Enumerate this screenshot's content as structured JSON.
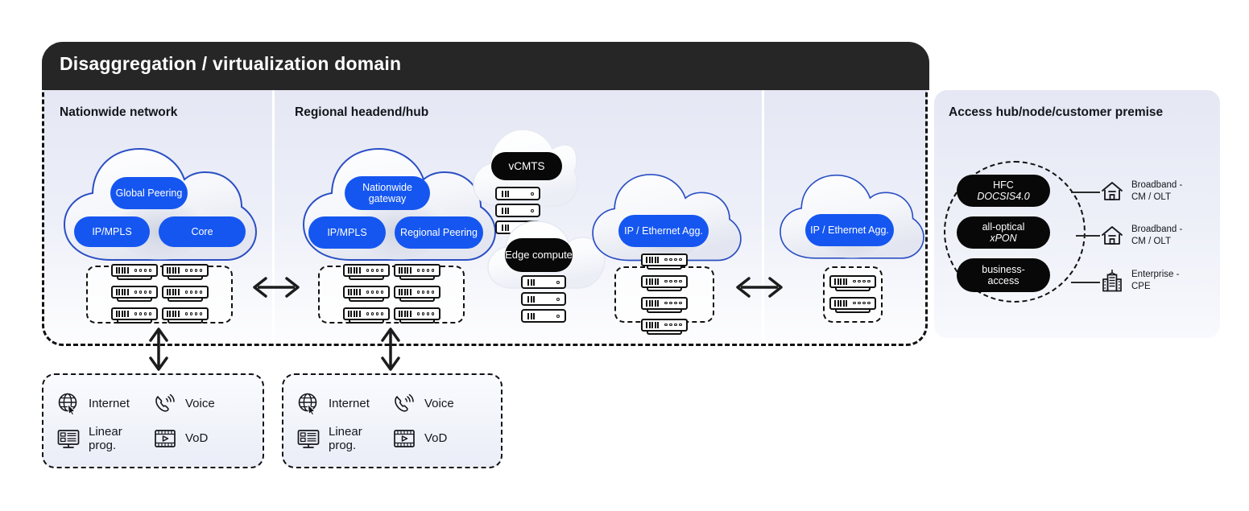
{
  "diagram": {
    "domain": {
      "title": "Disaggregation / virtualization domain",
      "zones": [
        {
          "id": "nationwide",
          "title": "Nationwide network"
        },
        {
          "id": "regional",
          "title": "Regional headend/hub"
        },
        {
          "id": "aggregation",
          "title": ""
        }
      ]
    },
    "access_panel": {
      "title": "Access hub/node/customer premise"
    },
    "clouds": [
      {
        "id": "nationwide-network-cloud",
        "zone": "nationwide",
        "pills": [
          {
            "label": "Global Peering",
            "color": "#1556f0"
          },
          {
            "label": "IP/MPLS",
            "color": "#1556f0"
          },
          {
            "label": "Core",
            "color": "#1556f0"
          }
        ],
        "servers": 6
      },
      {
        "id": "regional-headend-cloud",
        "zone": "regional",
        "pills": [
          {
            "label": "Nationwide gateway",
            "color": "#1556f0"
          },
          {
            "label": "IP/MPLS",
            "color": "#1556f0"
          },
          {
            "label": "Regional Peering",
            "color": "#1556f0"
          }
        ],
        "servers": 6
      },
      {
        "id": "vcmts-cloud",
        "zone": "regional",
        "pills": [
          {
            "label": "vCMTS",
            "color": "#080808"
          }
        ],
        "servers": 3
      },
      {
        "id": "edge-compute-cloud",
        "zone": "regional",
        "pills": [
          {
            "label": "Edge compute",
            "color": "#080808"
          }
        ],
        "servers": 3
      },
      {
        "id": "regional-ip-ethernet-agg-cloud",
        "zone": "regional",
        "pills": [
          {
            "label": "IP / Ethernet Agg.",
            "color": "#1556f0"
          }
        ],
        "servers": 4
      },
      {
        "id": "access-ip-ethernet-agg-cloud",
        "zone": "aggregation",
        "pills": [
          {
            "label": "IP / Ethernet Agg.",
            "color": "#1556f0"
          }
        ],
        "servers": 2
      }
    ],
    "cloud_labels": {
      "global_peering": "Global Peering",
      "ip_mpls_1": "IP/MPLS",
      "core": "Core",
      "nationwide_gateway": "Nationwide gateway",
      "ip_mpls_2": "IP/MPLS",
      "regional_peering": "Regional Peering",
      "vcmts": "vCMTS",
      "edge_compute": "Edge compute",
      "ip_eth_agg_1": "IP / Ethernet Agg.",
      "ip_eth_agg_2": "IP / Ethernet Agg."
    },
    "access_technologies": [
      {
        "line1": "HFC",
        "line2": "DOCSIS4.0",
        "italic2": true
      },
      {
        "line1": "all-optical",
        "line2": "xPON",
        "italic2": true
      },
      {
        "line1": "business-",
        "line2": "access",
        "italic2": false
      }
    ],
    "customer_endpoints": [
      {
        "icon": "house-icon",
        "label": "Broadband -\nCM / OLT"
      },
      {
        "icon": "house-icon",
        "label": "Broadband -\nCM / OLT"
      },
      {
        "icon": "office-building-icon",
        "label": "Enterprise -\nCPE"
      }
    ],
    "service_boxes": [
      {
        "id": "nationwide-services",
        "items": [
          {
            "icon": "globe-cursor-icon",
            "label": "Internet"
          },
          {
            "icon": "phone-ring-icon",
            "label": "Voice"
          },
          {
            "icon": "monitor-list-icon",
            "label": "Linear prog."
          },
          {
            "icon": "film-play-icon",
            "label": "VoD"
          }
        ]
      },
      {
        "id": "regional-services",
        "items": [
          {
            "icon": "globe-cursor-icon",
            "label": "Internet"
          },
          {
            "icon": "phone-ring-icon",
            "label": "Voice"
          },
          {
            "icon": "monitor-list-icon",
            "label": "Linear prog."
          },
          {
            "icon": "film-play-icon",
            "label": "VoD"
          }
        ]
      }
    ],
    "connectors": [
      {
        "id": "nationwide-to-regional",
        "type": "horizontal-double-arrow"
      },
      {
        "id": "regional-to-access-agg",
        "type": "horizontal-double-arrow"
      },
      {
        "id": "nationwide-to-services",
        "type": "vertical-double-arrow"
      },
      {
        "id": "regional-to-services",
        "type": "vertical-double-arrow"
      }
    ],
    "colors": {
      "accent_blue": "#1556f0",
      "panel_dark": "#262626",
      "pill_black": "#080808",
      "panel_bg_top": "#e5e8f4",
      "panel_bg_bottom": "#fdfdfe",
      "cloud_stroke": "#2a4fc4"
    }
  }
}
